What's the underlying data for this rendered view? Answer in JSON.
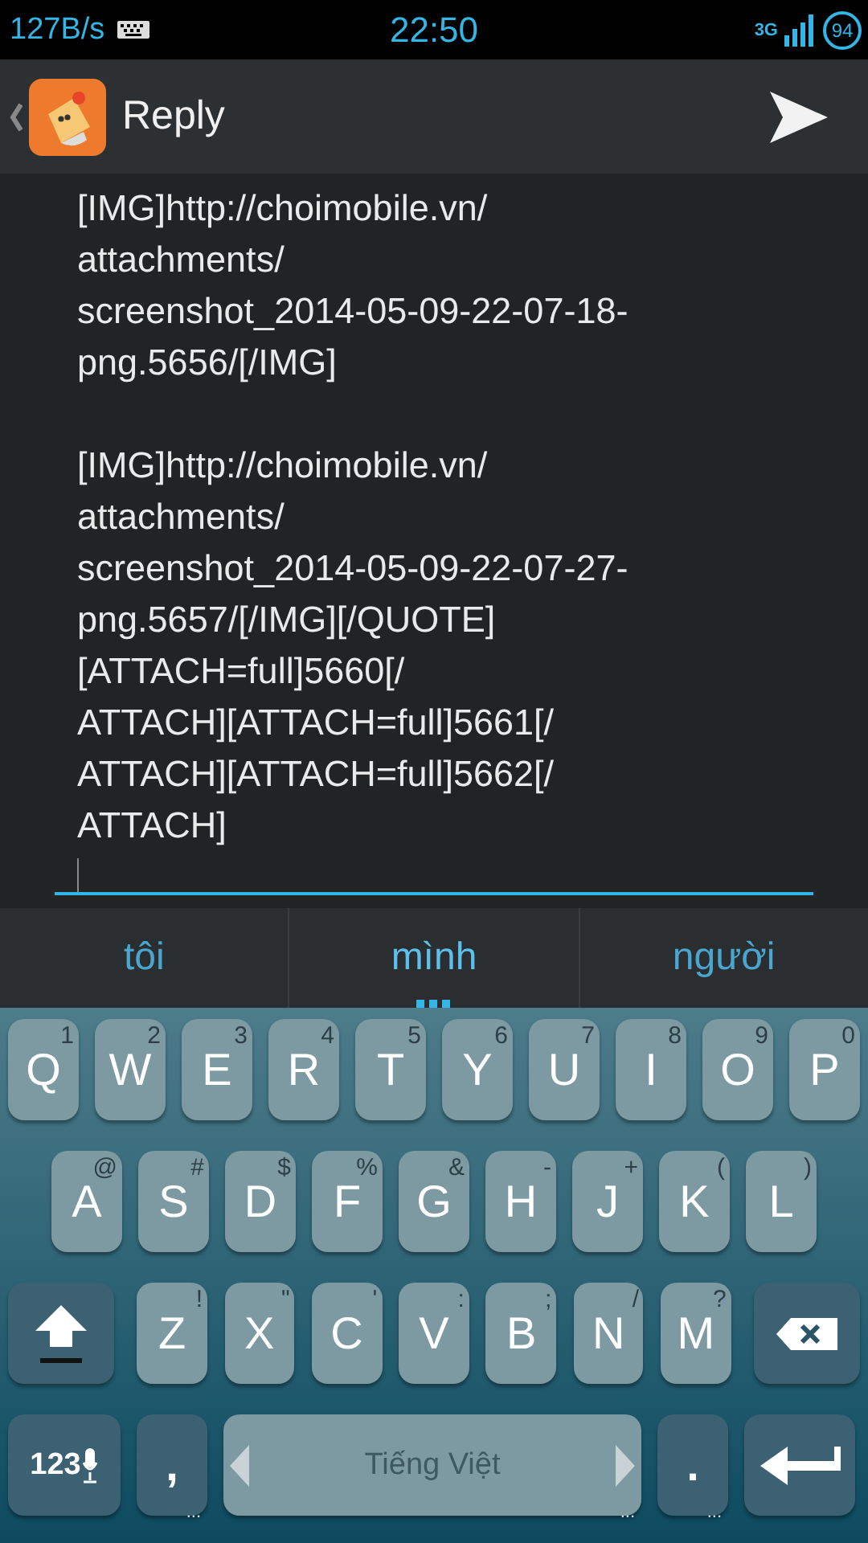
{
  "status_bar": {
    "speed": "127B/s",
    "time": "22:50",
    "network": "3G",
    "battery": "94"
  },
  "app_bar": {
    "title": "Reply"
  },
  "editor": {
    "paragraphs": [
      {
        "lines": [
          "[IMG]http://choimobile.vn/",
          "attachments/",
          "screenshot_2014-05-09-22-07-18-",
          "png.5656/[/IMG]"
        ]
      },
      {
        "lines": [
          "[IMG]http://choimobile.vn/",
          "attachments/",
          "screenshot_2014-05-09-22-07-27-",
          "png.5657/[/IMG][/QUOTE]",
          "[ATTACH=full]5660[/",
          "ATTACH][ATTACH=full]5661[/",
          "ATTACH][ATTACH=full]5662[/",
          "ATTACH]"
        ]
      }
    ]
  },
  "suggestions": [
    {
      "text": "tôi",
      "selected": false
    },
    {
      "text": "mình",
      "selected": true
    },
    {
      "text": "người",
      "selected": false
    }
  ],
  "keyboard": {
    "top_row": [
      {
        "kind": "letter",
        "label": "Q",
        "hint": "1"
      },
      {
        "kind": "letter",
        "label": "W",
        "hint": "2"
      },
      {
        "kind": "letter",
        "label": "E",
        "hint": "3"
      },
      {
        "kind": "letter",
        "label": "R",
        "hint": "4"
      },
      {
        "kind": "letter",
        "label": "T",
        "hint": "5"
      },
      {
        "kind": "letter",
        "label": "Y",
        "hint": "6"
      },
      {
        "kind": "letter",
        "label": "U",
        "hint": "7"
      },
      {
        "kind": "letter",
        "label": "I",
        "hint": "8"
      },
      {
        "kind": "letter",
        "label": "O",
        "hint": "9"
      },
      {
        "kind": "letter",
        "label": "P",
        "hint": "0"
      }
    ],
    "middle_row": [
      {
        "kind": "letter",
        "label": "A",
        "hint": "@"
      },
      {
        "kind": "letter",
        "label": "S",
        "hint": "#"
      },
      {
        "kind": "letter",
        "label": "D",
        "hint": "$"
      },
      {
        "kind": "letter",
        "label": "F",
        "hint": "%"
      },
      {
        "kind": "letter",
        "label": "G",
        "hint": "&"
      },
      {
        "kind": "letter",
        "label": "H",
        "hint": "-"
      },
      {
        "kind": "letter",
        "label": "J",
        "hint": "+"
      },
      {
        "kind": "letter",
        "label": "K",
        "hint": "("
      },
      {
        "kind": "letter",
        "label": "L",
        "hint": ")"
      }
    ],
    "bottom_row": [
      {
        "kind": "shift"
      },
      {
        "kind": "letter",
        "label": "Z",
        "hint": "!"
      },
      {
        "kind": "letter",
        "label": "X",
        "hint": "\""
      },
      {
        "kind": "letter",
        "label": "C",
        "hint": "'"
      },
      {
        "kind": "letter",
        "label": "V",
        "hint": ":"
      },
      {
        "kind": "letter",
        "label": "B",
        "hint": ";"
      },
      {
        "kind": "letter",
        "label": "N",
        "hint": "/"
      },
      {
        "kind": "letter",
        "label": "M",
        "hint": "?"
      },
      {
        "kind": "backspace"
      }
    ],
    "control_row": [
      {
        "kind": "symbols",
        "label": "123"
      },
      {
        "kind": "comma",
        "label": ",",
        "hint": "..."
      },
      {
        "kind": "space",
        "label": "Tiếng Việt",
        "hint": "..."
      },
      {
        "kind": "period",
        "label": ".",
        "hint": "..."
      },
      {
        "kind": "enter"
      }
    ]
  }
}
